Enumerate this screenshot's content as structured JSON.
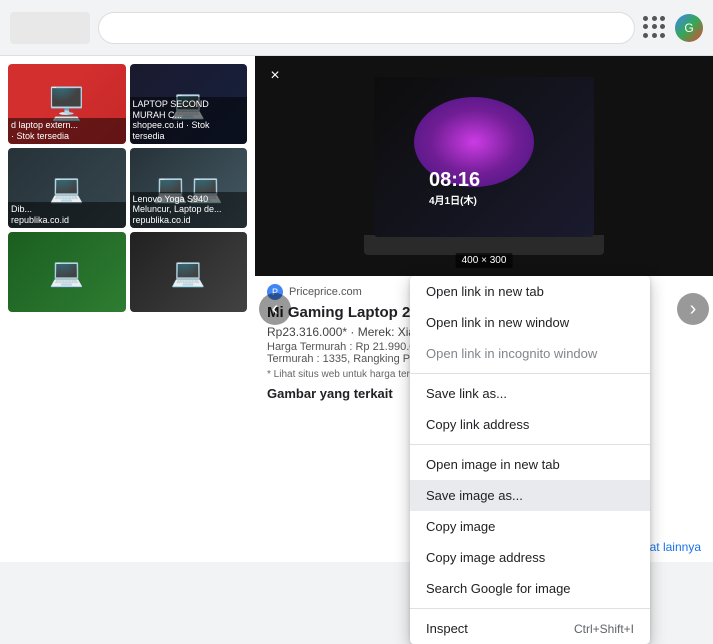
{
  "chrome": {
    "grid_icon_title": "Google apps",
    "profile_icon_title": "Google Account"
  },
  "left_sidebar": {
    "items": [
      {
        "label": "d laptop extern...\n· Stok tersedia",
        "source": "i · Stok tersedia"
      },
      {
        "label": "LAPTOP SECOND MURAH C...\nshopee.co.id · Stok tersedia",
        "source": "shopee.co.id · Stok tersedia"
      },
      {
        "label": "Dib...\nrepublika.co.id",
        "source": "republika.co.id"
      },
      {
        "label": "Lenovo Yoga S940 Meluncur, Laptop de...\nrepublika.co.id",
        "source": "republika.co.id"
      },
      {
        "label": "",
        "source": ""
      },
      {
        "label": "",
        "source": ""
      }
    ]
  },
  "panel": {
    "close_label": "×",
    "nav_left": "‹",
    "nav_right": "›",
    "time_text": "08:16",
    "date_text": "4月1日(木)",
    "image_size": "400 × 300",
    "source_name": "Priceprice.com",
    "product_title": "Mi Gaming Laptop 20",
    "product_price": "Rp23.316.000* · Merek: Xiaom",
    "product_detail_1": "Harga Termurah : Rp 21.990.00",
    "product_detail_2": "Termurah : 1335, Rangking Pe",
    "product_note": "* Lihat situs web untuk harga terbar\ncipta. Pelajari Lebih Lanjut",
    "related_label": "Gambar yang terkait",
    "lihat_lainnya": "Lihat lainnya"
  },
  "context_menu": {
    "items": [
      {
        "id": "open-new-tab",
        "label": "Open link in new tab",
        "shortcut": "",
        "disabled": false,
        "highlighted": false
      },
      {
        "id": "open-new-window",
        "label": "Open link in new window",
        "shortcut": "",
        "disabled": false,
        "highlighted": false
      },
      {
        "id": "open-incognito",
        "label": "Open link in incognito window",
        "shortcut": "",
        "disabled": false,
        "highlighted": false
      },
      {
        "id": "divider1",
        "type": "divider"
      },
      {
        "id": "save-link",
        "label": "Save link as...",
        "shortcut": "",
        "disabled": false,
        "highlighted": false
      },
      {
        "id": "copy-link",
        "label": "Copy link address",
        "shortcut": "",
        "disabled": false,
        "highlighted": false
      },
      {
        "id": "divider2",
        "type": "divider"
      },
      {
        "id": "open-image-tab",
        "label": "Open image in new tab",
        "shortcut": "",
        "disabled": false,
        "highlighted": false
      },
      {
        "id": "save-image",
        "label": "Save image as...",
        "shortcut": "",
        "disabled": false,
        "highlighted": true
      },
      {
        "id": "copy-image",
        "label": "Copy image",
        "shortcut": "",
        "disabled": false,
        "highlighted": false
      },
      {
        "id": "copy-image-address",
        "label": "Copy image address",
        "shortcut": "",
        "disabled": false,
        "highlighted": false
      },
      {
        "id": "search-google",
        "label": "Search Google for image",
        "shortcut": "",
        "disabled": false,
        "highlighted": false
      },
      {
        "id": "divider3",
        "type": "divider"
      },
      {
        "id": "inspect",
        "label": "Inspect",
        "shortcut": "Ctrl+Shift+I",
        "disabled": false,
        "highlighted": false
      }
    ]
  }
}
